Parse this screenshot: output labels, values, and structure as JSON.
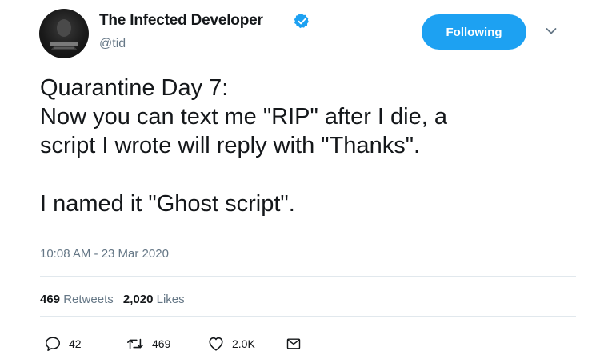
{
  "author": {
    "display_name": "The Infected Developer",
    "handle": "@tid",
    "verified": true,
    "avatar_icon": "avatar-image"
  },
  "follow_button": {
    "label": "Following",
    "color": "#1da1f2"
  },
  "menu_caret_icon": "chevron-down-icon",
  "tweet": {
    "lines": [
      "Quarantine Day 7:",
      "Now you can text me \"RIP\" after I die, a",
      "script I wrote will reply with \"Thanks\".",
      "",
      "I named it \"Ghost script\"."
    ],
    "timestamp": "10:08 AM - 23 Mar 2020"
  },
  "stats": {
    "retweets_count": "469",
    "retweets_label": "Retweets",
    "likes_count": "2,020",
    "likes_label": "Likes"
  },
  "actions": {
    "reply": {
      "icon": "reply-icon",
      "count": "42"
    },
    "retweet": {
      "icon": "retweet-icon",
      "count": "469"
    },
    "like": {
      "icon": "heart-icon",
      "count": "2.0K"
    },
    "message": {
      "icon": "envelope-icon"
    }
  },
  "colors": {
    "text": "#14171a",
    "secondary": "#657786",
    "accent": "#1da1f2",
    "divider": "#e1e8ed"
  }
}
